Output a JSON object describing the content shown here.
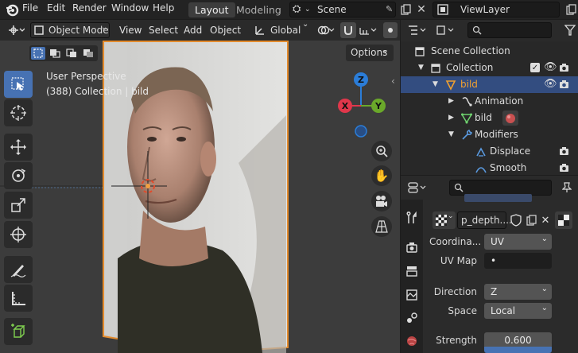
{
  "menubar": {
    "items": [
      "File",
      "Edit",
      "Render",
      "Window",
      "Help"
    ],
    "workspaces": [
      "Layout",
      "Modeling"
    ],
    "scene": "Scene",
    "view_layer": "ViewLayer"
  },
  "viewport_header": {
    "mode": "Object Mode",
    "menus": [
      "View",
      "Select",
      "Add",
      "Object"
    ],
    "transform_orientation": "Global",
    "options": "Options"
  },
  "viewport": {
    "perspective": "User Perspective",
    "collection_info": "(388) Collection | bild",
    "gizmo": {
      "x": "X",
      "y": "Y",
      "z": "Z"
    }
  },
  "outliner": {
    "rows": [
      {
        "label": "Scene Collection"
      },
      {
        "label": "Collection"
      },
      {
        "label": "bild"
      },
      {
        "label": "Animation"
      },
      {
        "label": "bild"
      },
      {
        "label": "Modifiers"
      },
      {
        "label": "Displace"
      },
      {
        "label": "Smooth"
      }
    ]
  },
  "properties": {
    "texture_name": "p_depth....",
    "fields": [
      {
        "label": "Coordina...",
        "value": "UV"
      },
      {
        "label": "UV Map",
        "value": "•"
      },
      {
        "label": "Direction",
        "value": "Z"
      },
      {
        "label": "Space",
        "value": "Local"
      },
      {
        "label": "Strength",
        "value": "0.600"
      }
    ]
  },
  "colors": {
    "accent": "#4772b3",
    "selection": "#334d80",
    "axis_x": "#e0374b",
    "axis_y": "#6aa82a",
    "axis_z": "#2b7dd8"
  }
}
